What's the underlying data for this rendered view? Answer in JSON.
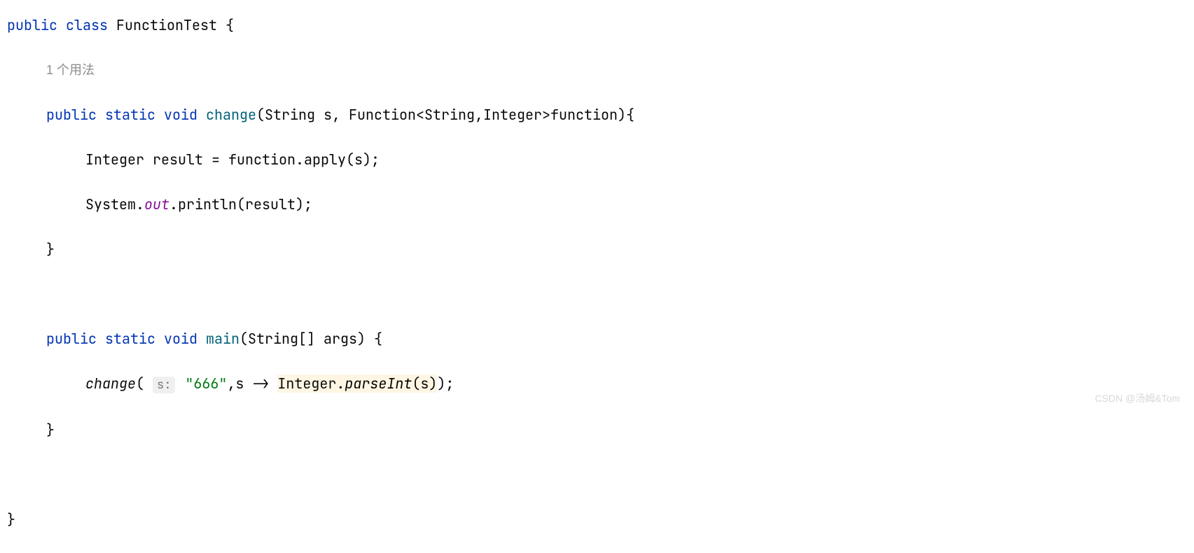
{
  "code": {
    "line1": {
      "k_public": "public",
      "k_class": "class",
      "class_name": "FunctionTest",
      "brace": " {"
    },
    "usage_hint": "1 个用法",
    "line3": {
      "k_public": "public",
      "k_static": "static",
      "k_void": "void",
      "method": "change",
      "sig_open": "(",
      "p1_type": "String",
      "p1_name": " s, ",
      "p2_type": "Function",
      "generics": "<String,Integer>",
      "p2_name": "function",
      "sig_close": "){"
    },
    "line4": {
      "type": "Integer",
      "rest": " result = function.apply(s);"
    },
    "line5": {
      "sys": "System.",
      "out": "out",
      "rest": ".println(result);"
    },
    "line6": "}",
    "line8": {
      "k_public": "public",
      "k_static": "static",
      "k_void": "void",
      "method": "main",
      "sig_open": "(",
      "p_type": "String",
      "p_arr": "[] args",
      "sig_close": ") {"
    },
    "line9": {
      "call": "change",
      "open": "( ",
      "hint": "s:",
      "str": "\"666\"",
      "mid": ",s -> ",
      "hl_type": "Integer.",
      "hl_method": "parseInt",
      "hl_arg": "(s)",
      "close": ");"
    },
    "line10": "}",
    "line12": "}"
  },
  "watermark": "CSDN @汤姆&Tom"
}
